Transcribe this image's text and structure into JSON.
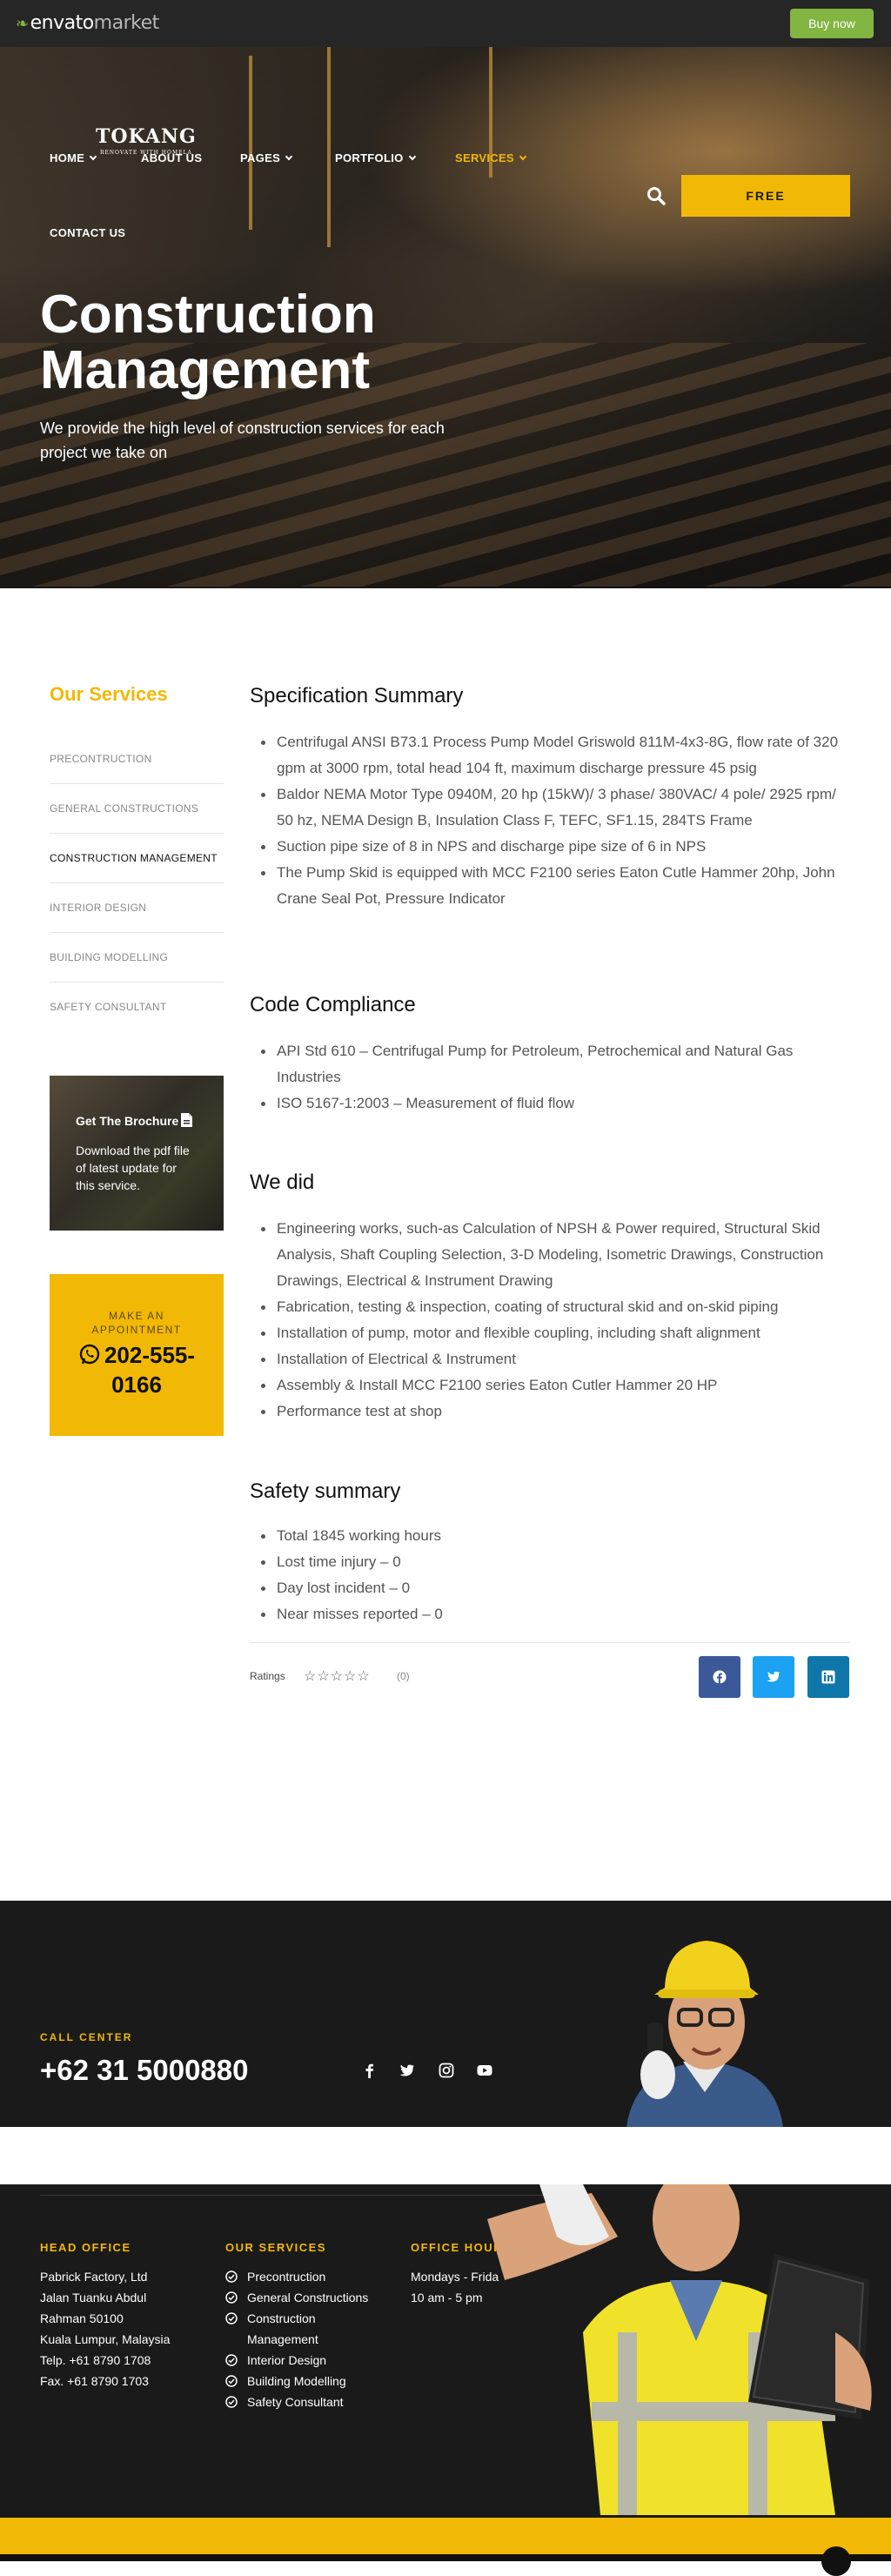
{
  "envato": {
    "logo_main": "envato",
    "logo_market": "market",
    "buy_label": "Buy now"
  },
  "brand": {
    "name": "TOKANG",
    "tagline": "RENOVATE WITH HOMELA"
  },
  "nav": {
    "items": [
      {
        "label": "HOME",
        "has_dropdown": true
      },
      {
        "label": "ABOUT US",
        "has_dropdown": false
      },
      {
        "label": "PAGES",
        "has_dropdown": true
      },
      {
        "label": "PORTFOLIO",
        "has_dropdown": true
      },
      {
        "label": "SERVICES",
        "has_dropdown": true,
        "active": true
      },
      {
        "label": "CONTACT US",
        "has_dropdown": false
      }
    ],
    "free_label": "FREE",
    "search_icon": "search-icon"
  },
  "hero": {
    "title": "Construction Management",
    "subtitle": "We provide the high level of construction services for each project we take on"
  },
  "sidebar": {
    "title": "Our Services",
    "items": [
      {
        "label": "PRECONTRUCTION"
      },
      {
        "label": "GENERAL CONSTRUCTIONS"
      },
      {
        "label": "CONSTRUCTION MANAGEMENT",
        "active": true
      },
      {
        "label": "INTERIOR DESIGN"
      },
      {
        "label": "BUILDING MODELLING"
      },
      {
        "label": "SAFETY CONSULTANT"
      }
    ],
    "brochure": {
      "title": "Get The Brochure",
      "text": "Download the pdf file of latest update for this service."
    },
    "appointment": {
      "label": "MAKE AN APPOINTMENT",
      "phone": "202-555-0166"
    }
  },
  "main": {
    "spec": {
      "heading": "Specification Summary",
      "items": [
        "Centrifugal ANSI B73.1 Process Pump Model Griswold 811M-4x3-8G, flow rate of 320 gpm  at 3000 rpm, total head 104 ft, maximum discharge pressure 45 psig",
        "Baldor NEMA Motor Type 0940M, 20 hp (15kW)/ 3 phase/ 380VAC/ 4 pole/ 2925 rpm/ 50 hz, NEMA Design B, Insulation Class F, TEFC, SF1.15, 284TS Frame",
        "Suction pipe size of 8 in NPS and discharge pipe size of 6 in NPS",
        "The Pump Skid is equipped with MCC F2100 series Eaton Cutle Hammer 20hp, John Crane Seal Pot, Pressure Indicator"
      ]
    },
    "code": {
      "heading": "Code Compliance",
      "items": [
        "API Std 610 – Centrifugal Pump for Petroleum, Petrochemical and Natural Gas Industries",
        "ISO 5167-1:2003 – Measurement of fluid flow"
      ]
    },
    "did": {
      "heading": "We did",
      "items": [
        "Engineering works, such-as Calculation of NPSH & Power required, Structural Skid Analysis, Shaft Coupling Selection, 3-D Modeling, Isometric Drawings, Construction Drawings, Electrical & Instrument Drawing",
        "Fabrication, testing & inspection, coating of structural skid and on-skid piping",
        "Installation of pump, motor and flexible coupling, including shaft alignment",
        "Installation of Electrical & Instrument",
        "Assembly & Install MCC F2100 series Eaton Cutler Hammer 20 HP",
        "Performance test at shop"
      ]
    },
    "safety": {
      "heading": "Safety summary",
      "items": [
        "Total 1845 working hours",
        "Lost time injury – 0",
        "Day lost incident – 0",
        "Near misses reported – 0"
      ]
    },
    "ratings": {
      "label": "Ratings",
      "stars": "☆☆☆☆☆",
      "count": "(0)"
    },
    "share": [
      {
        "network": "facebook-icon",
        "color": "#3b5998"
      },
      {
        "network": "twitter-icon",
        "color": "#1da1f2"
      },
      {
        "network": "linkedin-icon",
        "color": "#0e76a8"
      }
    ]
  },
  "footer": {
    "call_center": {
      "label": "CALL CENTER",
      "phone": "+62 31 5000880"
    },
    "social": [
      "facebook-icon",
      "twitter-icon",
      "instagram-icon",
      "youtube-icon"
    ],
    "office": {
      "heading": "HEAD OFFICE",
      "lines": "Pabrick Factory, Ltd\nJalan Tuanku Abdul\nRahman 50100\nKuala Lumpur, Malaysia\nTelp. +61 8790 1708\nFax. +61 8790 1703"
    },
    "services": {
      "heading": "OUR SERVICES",
      "items": [
        "Precontruction",
        "General Constructions",
        "Construction Management",
        "Interior Design",
        "Building Modelling",
        "Safety Consultant"
      ]
    },
    "hours": {
      "heading": "OFFICE HOUR",
      "days": "Mondays - Frida",
      "time": "10 am - 5 pm"
    }
  },
  "colors": {
    "accent": "#f2b806",
    "dark": "#1a1a1a",
    "envato_green": "#82b541"
  }
}
